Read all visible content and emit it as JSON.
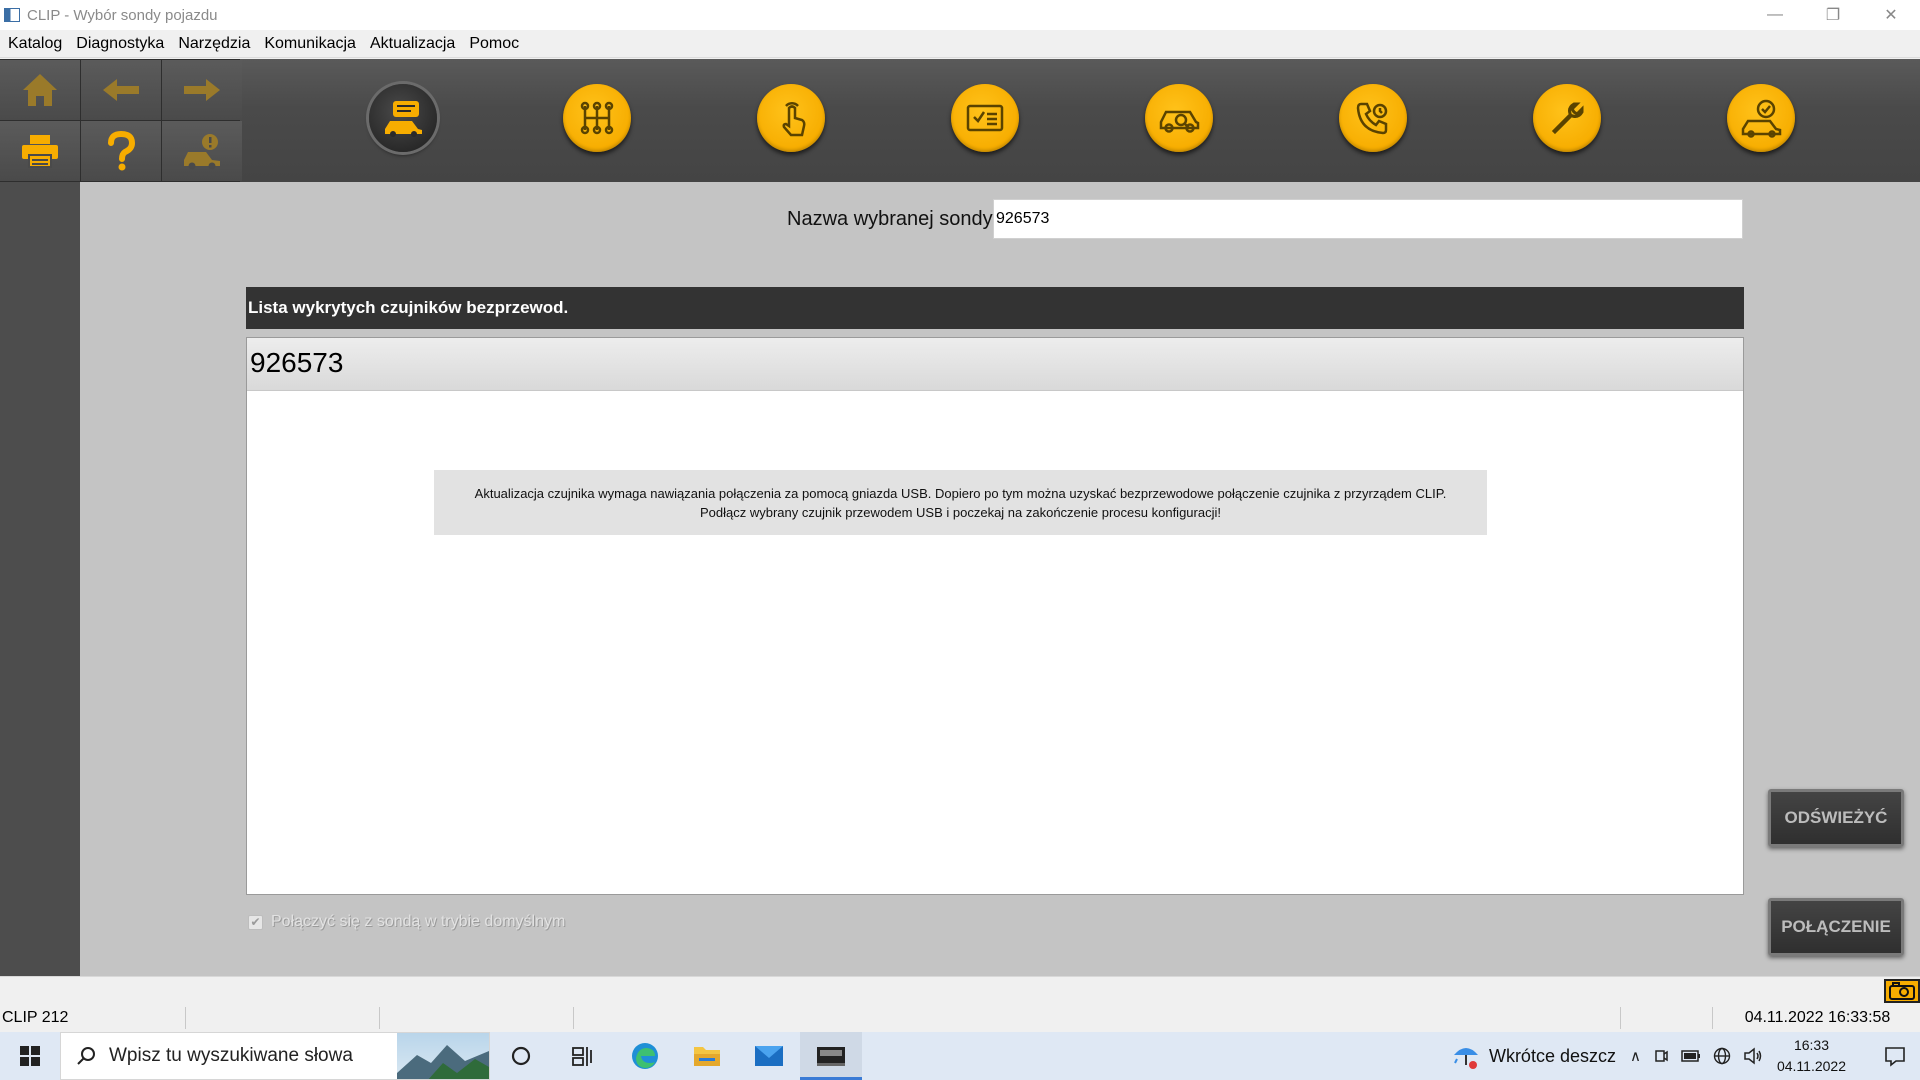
{
  "window": {
    "title": "CLIP - Wybór sondy pojazdu",
    "minimize": "—",
    "restore": "❐",
    "close": "✕"
  },
  "menu": [
    "Katalog",
    "Diagnostyka",
    "Narzędzia",
    "Komunikacja",
    "Aktualizacja",
    "Pomoc"
  ],
  "toolbar": {
    "left_buttons": [
      "home-icon",
      "arrow-left-icon",
      "arrow-right-icon",
      "printer-icon",
      "help-icon",
      "vehicle-info-icon"
    ],
    "circle_buttons": [
      "vehicle-probe-icon",
      "gearbox-icon",
      "touch-icon",
      "checklist-icon",
      "vehicle-diagnostic-icon",
      "call-support-icon",
      "wrench-icon",
      "vehicle-check-icon"
    ],
    "active_index": 0,
    "accent_color": "#f7ad00"
  },
  "probe": {
    "label": "Nazwa wybranej sondy",
    "value": "926573"
  },
  "list": {
    "header": "Lista wykrytych czujników bezprzewod.",
    "items": [
      "926573"
    ],
    "message_line1": "Aktualizacja czujnika wymaga nawiązania połączenia za pomocą gniazda USB. Dopiero po tym można uzyskać bezprzewodowe połączenie czujnika z przyrządem CLIP.",
    "message_line2": "Podłącz wybrany czujnik przewodem USB i poczekaj na zakończenie procesu konfiguracji!"
  },
  "default_mode": {
    "label": "Połączyć się z sondą w trybie domyślnym",
    "checked": true
  },
  "buttons": {
    "refresh": "ODŚWIEŻYĆ",
    "connect": "POŁĄCZENIE"
  },
  "status": {
    "version": "CLIP 212",
    "datetime": "04.11.2022 16:33:58"
  },
  "taskbar": {
    "search_placeholder": "Wpisz tu wyszukiwane słowa",
    "weather": "Wkrótce deszcz",
    "time": "16:33",
    "date": "04.11.2022"
  }
}
